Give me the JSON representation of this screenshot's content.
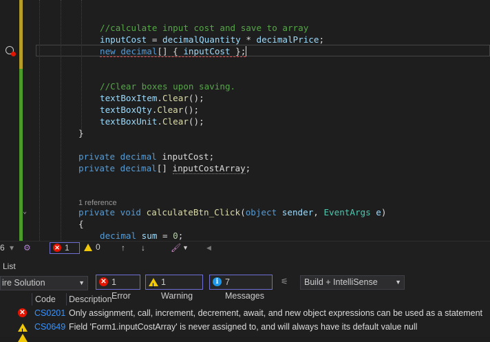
{
  "editor": {
    "code_lines": {
      "l1": "//calculate input cost and save to array",
      "l2a": "inputCost",
      "l2b": " = ",
      "l2c": "decimalQuantity",
      "l2d": " * ",
      "l2e": "decimalPrice",
      "l2f": ";",
      "l3a": "new",
      "l3b": " ",
      "l3c": "decimal",
      "l3d": "[] { ",
      "l3e": "inputCost",
      "l3f": " };",
      "l4": "//Clear boxes upon saving.",
      "l5a": "textBoxItem",
      "l5b": ".",
      "l5c": "Clear",
      "l5d": "();",
      "l6a": "textBoxQty",
      "l6b": ".",
      "l6c": "Clear",
      "l6d": "();",
      "l7a": "textBoxUnit",
      "l7b": ".",
      "l7c": "Clear",
      "l7d": "();",
      "l8": "}",
      "l9a": "private",
      "l9b": " ",
      "l9c": "decimal",
      "l9d": " inputCost;",
      "l10a": "private",
      "l10b": " ",
      "l10c": "decimal",
      "l10d": "[] ",
      "l10e": "inputCostArray",
      "l10f": ";",
      "l11a": "private",
      "l11b": " ",
      "l11c": "void",
      "l11d": " ",
      "l11e": "calculateBtn_Click",
      "l11f": "(",
      "l11g": "object",
      "l11h": " ",
      "l11i": "sender",
      "l11j": ", ",
      "l11k": "EventArgs",
      "l11l": " ",
      "l11m": "e",
      "l11n": ")",
      "l12": "{",
      "l13a": "decimal",
      "l13b": " ",
      "l13c": "sum",
      "l13d": " = ",
      "l13e": "0",
      "l13f": ";"
    },
    "codelens": "1 reference"
  },
  "editor_status": {
    "left_num": "6",
    "errors": "1",
    "warnings": "0"
  },
  "error_list": {
    "title": "List",
    "scope": "ire Solution",
    "filter_errors": "1 Error",
    "filter_warnings": "1 Warning",
    "filter_messages": "7 Messages",
    "build_option": "Build + IntelliSense",
    "col_code": "Code",
    "col_description": "Description",
    "rows": [
      {
        "code": "CS0201",
        "description": "Only assignment, call, increment, decrement, await, and new object expressions can be used as a statement"
      },
      {
        "code": "CS0649",
        "description": "Field 'Form1.inputCostArray' is never assigned to, and will always have its default value null"
      }
    ]
  },
  "colors": {
    "error": "#e51400",
    "warning": "#f0c808",
    "info": "#1c97ea",
    "link": "#3794ff"
  }
}
